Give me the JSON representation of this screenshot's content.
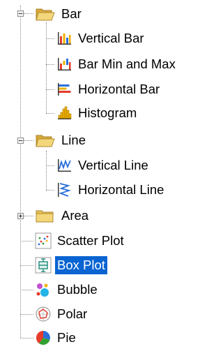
{
  "tree": {
    "bar": {
      "label": "Bar",
      "expanded": true,
      "children": [
        {
          "label": "Vertical Bar",
          "icon": "vertical-bar-chart-icon"
        },
        {
          "label": "Bar Min and Max",
          "icon": "bar-min-max-chart-icon"
        },
        {
          "label": "Horizontal Bar",
          "icon": "horizontal-bar-chart-icon"
        },
        {
          "label": "Histogram",
          "icon": "histogram-chart-icon"
        }
      ]
    },
    "line": {
      "label": "Line",
      "expanded": true,
      "children": [
        {
          "label": "Vertical Line",
          "icon": "vertical-line-chart-icon"
        },
        {
          "label": "Horizontal Line",
          "icon": "horizontal-line-chart-icon"
        }
      ]
    },
    "area": {
      "label": "Area",
      "expanded": false
    },
    "leaves": [
      {
        "label": "Scatter Plot",
        "icon": "scatter-plot-icon"
      },
      {
        "label": "Box Plot",
        "icon": "box-plot-icon",
        "selected": true
      },
      {
        "label": "Bubble",
        "icon": "bubble-chart-icon"
      },
      {
        "label": "Polar",
        "icon": "polar-chart-icon"
      },
      {
        "label": "Pie",
        "icon": "pie-chart-icon"
      }
    ]
  },
  "colors": {
    "selection": "#0a64d2",
    "folder": "#e8c25a",
    "connector": "#8a8a8a"
  }
}
